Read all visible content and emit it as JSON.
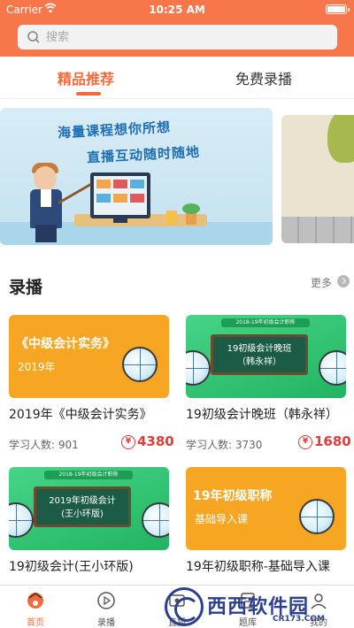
{
  "status_bar": {
    "carrier": "Carrier",
    "time": "10:25 AM"
  },
  "search": {
    "placeholder": "搜索"
  },
  "tabs": [
    {
      "label": "精品推荐",
      "active": true
    },
    {
      "label": "免费录播",
      "active": false
    }
  ],
  "banner": {
    "line1": "海量课程想你所想",
    "line2": "直播互动随时随地"
  },
  "section": {
    "title": "录播",
    "more": "更多"
  },
  "courses": [
    {
      "thumb_title": "《中级会计实务》",
      "thumb_sub": "2019年",
      "thumb_style": "orange",
      "title": "2019年《中级会计实务》",
      "learners": "学习人数: 901",
      "price": "4380"
    },
    {
      "thumb_header": "2018-19年初级会计职称",
      "thumb_board_1": "19初级会计晚班",
      "thumb_board_2": "（韩永祥）",
      "thumb_style": "green",
      "title": "19初级会计晚班（韩永祥）",
      "learners": "学习人数: 3730",
      "price": "1680"
    },
    {
      "thumb_header": "2018-19年初级会计职称",
      "thumb_board_1": "2019年初级会计",
      "thumb_board_2": "(王小环版)",
      "thumb_style": "green",
      "title": "19初级会计(王小环版)"
    },
    {
      "thumb_title": "19年初级职称",
      "thumb_sub": "基础导入课",
      "thumb_style": "orange",
      "title": "19年初级职称-基础导入课"
    }
  ],
  "price_symbol": "¥",
  "tabbar": [
    {
      "label": "首页",
      "icon": "home-icon",
      "active": true
    },
    {
      "label": "录播",
      "icon": "play-icon",
      "active": false
    },
    {
      "label": "直播",
      "icon": "live-icon",
      "active": false
    },
    {
      "label": "题库",
      "icon": "question-bank-icon",
      "active": false
    },
    {
      "label": "我的",
      "icon": "profile-icon",
      "active": false
    }
  ],
  "watermark": {
    "text": "西西软件园",
    "url": "CR173.COM"
  },
  "colors": {
    "accent": "#f7764a",
    "active_tab": "#f36b3d",
    "price": "#e33b3b",
    "green_card": "#21b463",
    "orange_card": "#f6a623"
  }
}
